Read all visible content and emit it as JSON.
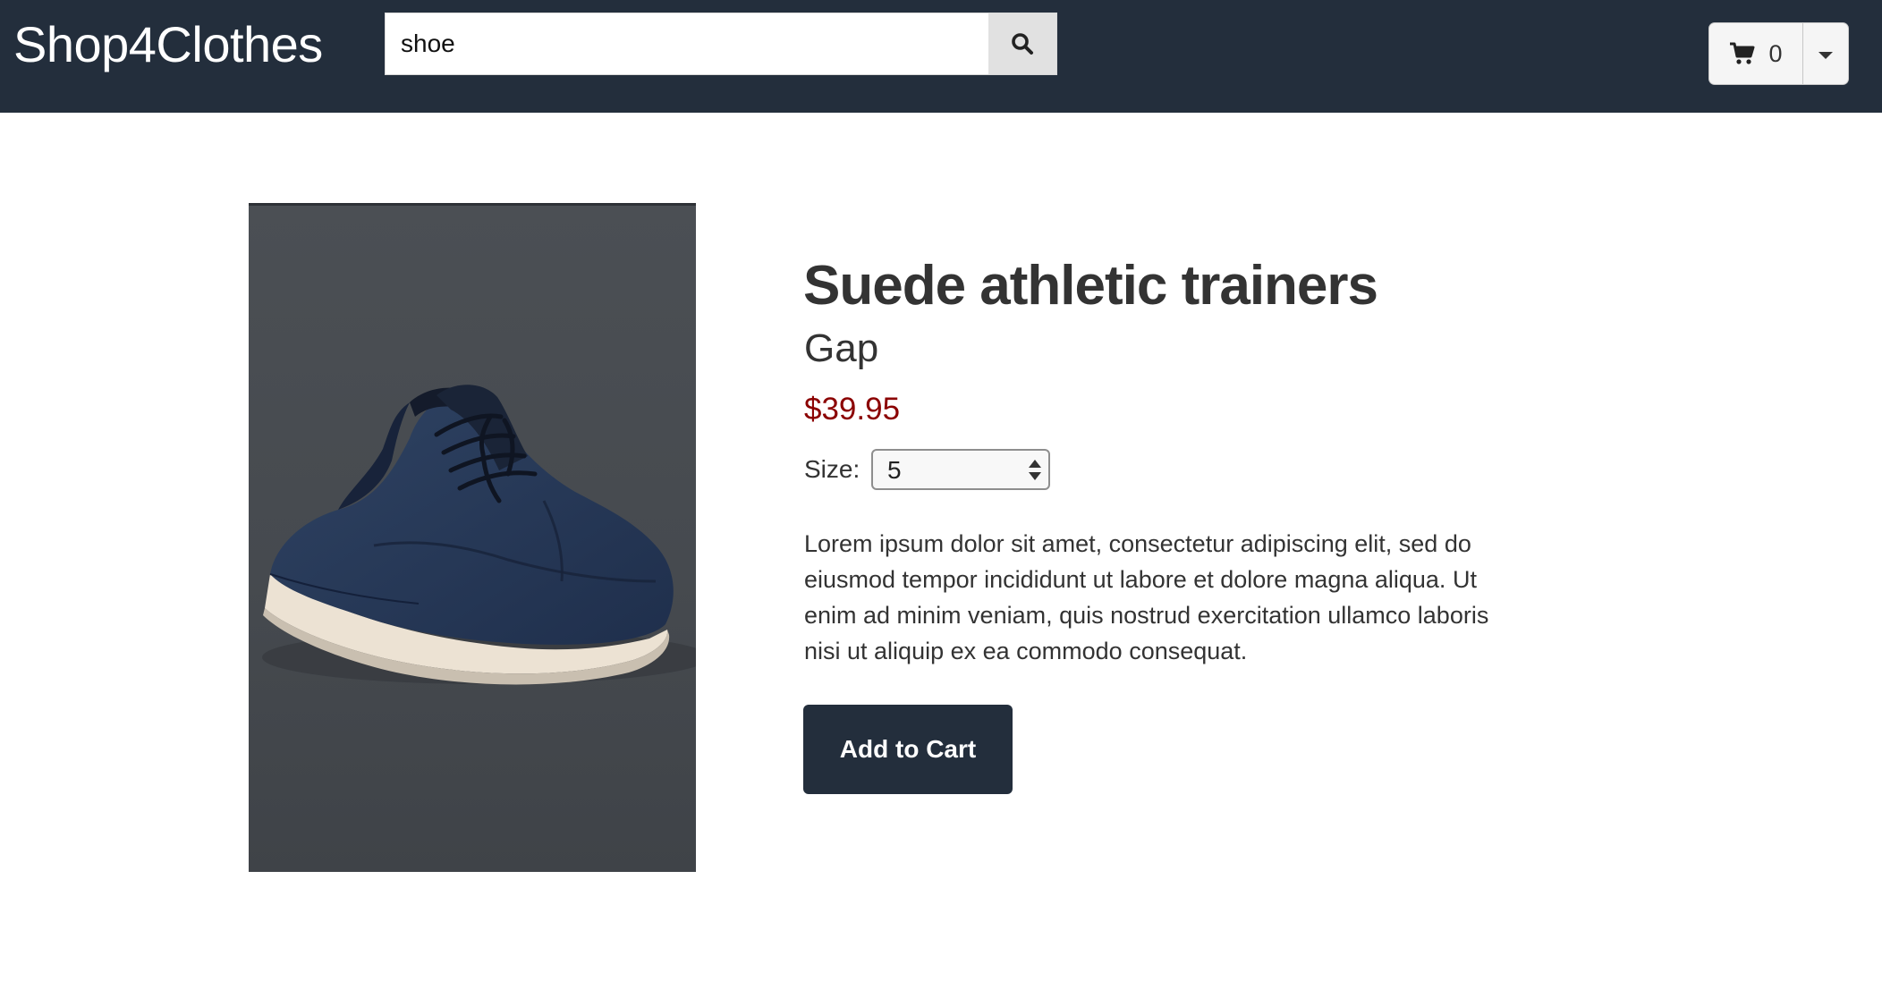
{
  "header": {
    "brand": "Shop4Clothes",
    "search": {
      "value": "shoe",
      "icon": "search-icon"
    },
    "cart": {
      "count": "0",
      "icon": "cart-icon",
      "dropdown_icon": "caret-down-icon"
    }
  },
  "product": {
    "image_alt": "navy suede athletic trainer",
    "title": "Suede athletic trainers",
    "brand": "Gap",
    "price": "$39.95",
    "size_label": "Size:",
    "size_selected": "5",
    "description": "Lorem ipsum dolor sit amet, consectetur adipiscing elit, sed do eiusmod tempor incididunt ut labore et dolore magna aliqua. Ut enim ad minim veniam, quis nostrud exercitation ullamco laboris nisi ut aliquip ex ea commodo consequat.",
    "add_to_cart_label": "Add to Cart"
  },
  "colors": {
    "navbar": "#232e3c",
    "price": "#8b0000",
    "button": "#232e3c"
  }
}
